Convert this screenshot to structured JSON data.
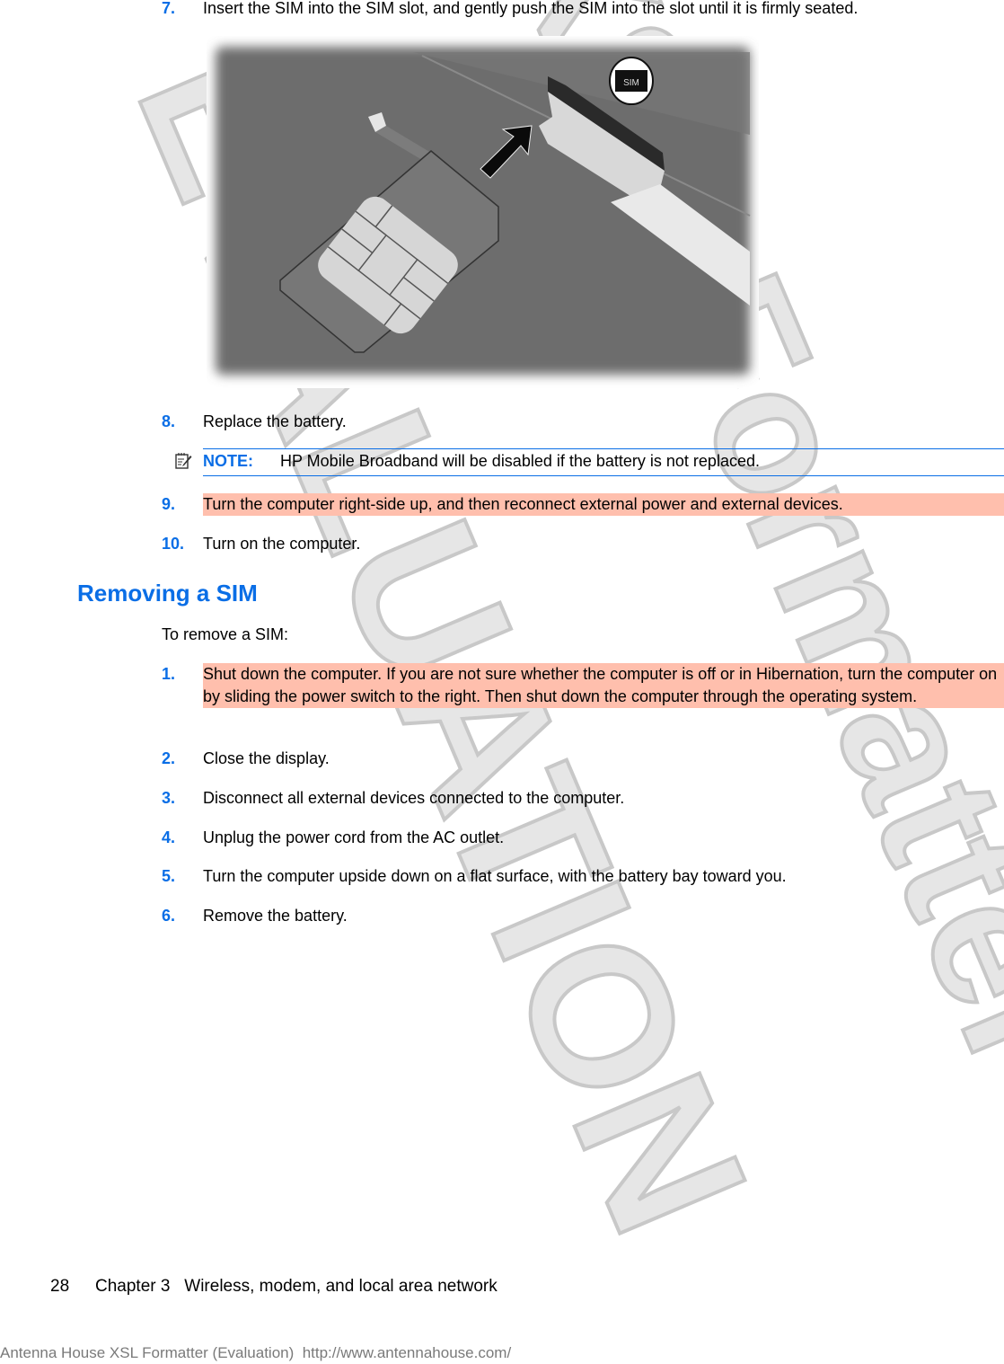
{
  "watermark": {
    "line1": "EVALUATION",
    "line2": "XSL Formatter",
    "fill_color": "#e6e6e6",
    "stroke_color": "#c8c8c8"
  },
  "colors": {
    "accent": "#0a6ee6",
    "highlight": "#ffbfad",
    "footer_gray": "#7a7a7a"
  },
  "steps_top": [
    {
      "number": "7.",
      "text": "Insert the SIM into the SIM slot, and gently push the SIM into the slot until it is firmly seated.",
      "highlighted": false
    },
    {
      "number": "8.",
      "text": "Replace the battery.",
      "highlighted": false
    },
    {
      "number": "9.",
      "text": "Turn the computer right-side up, and then reconnect external power and external devices.",
      "highlighted": true
    },
    {
      "number": "10.",
      "text": "Turn on the computer.",
      "highlighted": false
    }
  ],
  "figure": {
    "description": "SIM card being inserted into the SIM slot of a computer",
    "sim_label": "SIM"
  },
  "note": {
    "icon": "note-pencil-icon",
    "label": "NOTE:",
    "text": "HP Mobile Broadband will be disabled if the battery is not replaced."
  },
  "section": {
    "title": "Removing a SIM",
    "intro": "To remove a SIM:"
  },
  "steps_remove": [
    {
      "number": "1.",
      "text": "Shut down the computer. If you are not sure whether the computer is off or in Hibernation, turn the computer on by sliding the power switch to the right. Then shut down the computer through the operating system.",
      "highlighted": true
    },
    {
      "number": "2.",
      "text": "Close the display.",
      "highlighted": false
    },
    {
      "number": "3.",
      "text": "Disconnect all external devices connected to the computer.",
      "highlighted": false
    },
    {
      "number": "4.",
      "text": "Unplug the power cord from the AC outlet.",
      "highlighted": false
    },
    {
      "number": "5.",
      "text": "Turn the computer upside down on a flat surface, with the battery bay toward you.",
      "highlighted": false
    },
    {
      "number": "6.",
      "text": "Remove the battery.",
      "highlighted": false
    }
  ],
  "footer": {
    "page_number": "28",
    "chapter": "Chapter 3   Wireless, modem, and local area network",
    "evaluation_notice": "Antenna House XSL Formatter (Evaluation)  http://www.antennahouse.com/"
  }
}
